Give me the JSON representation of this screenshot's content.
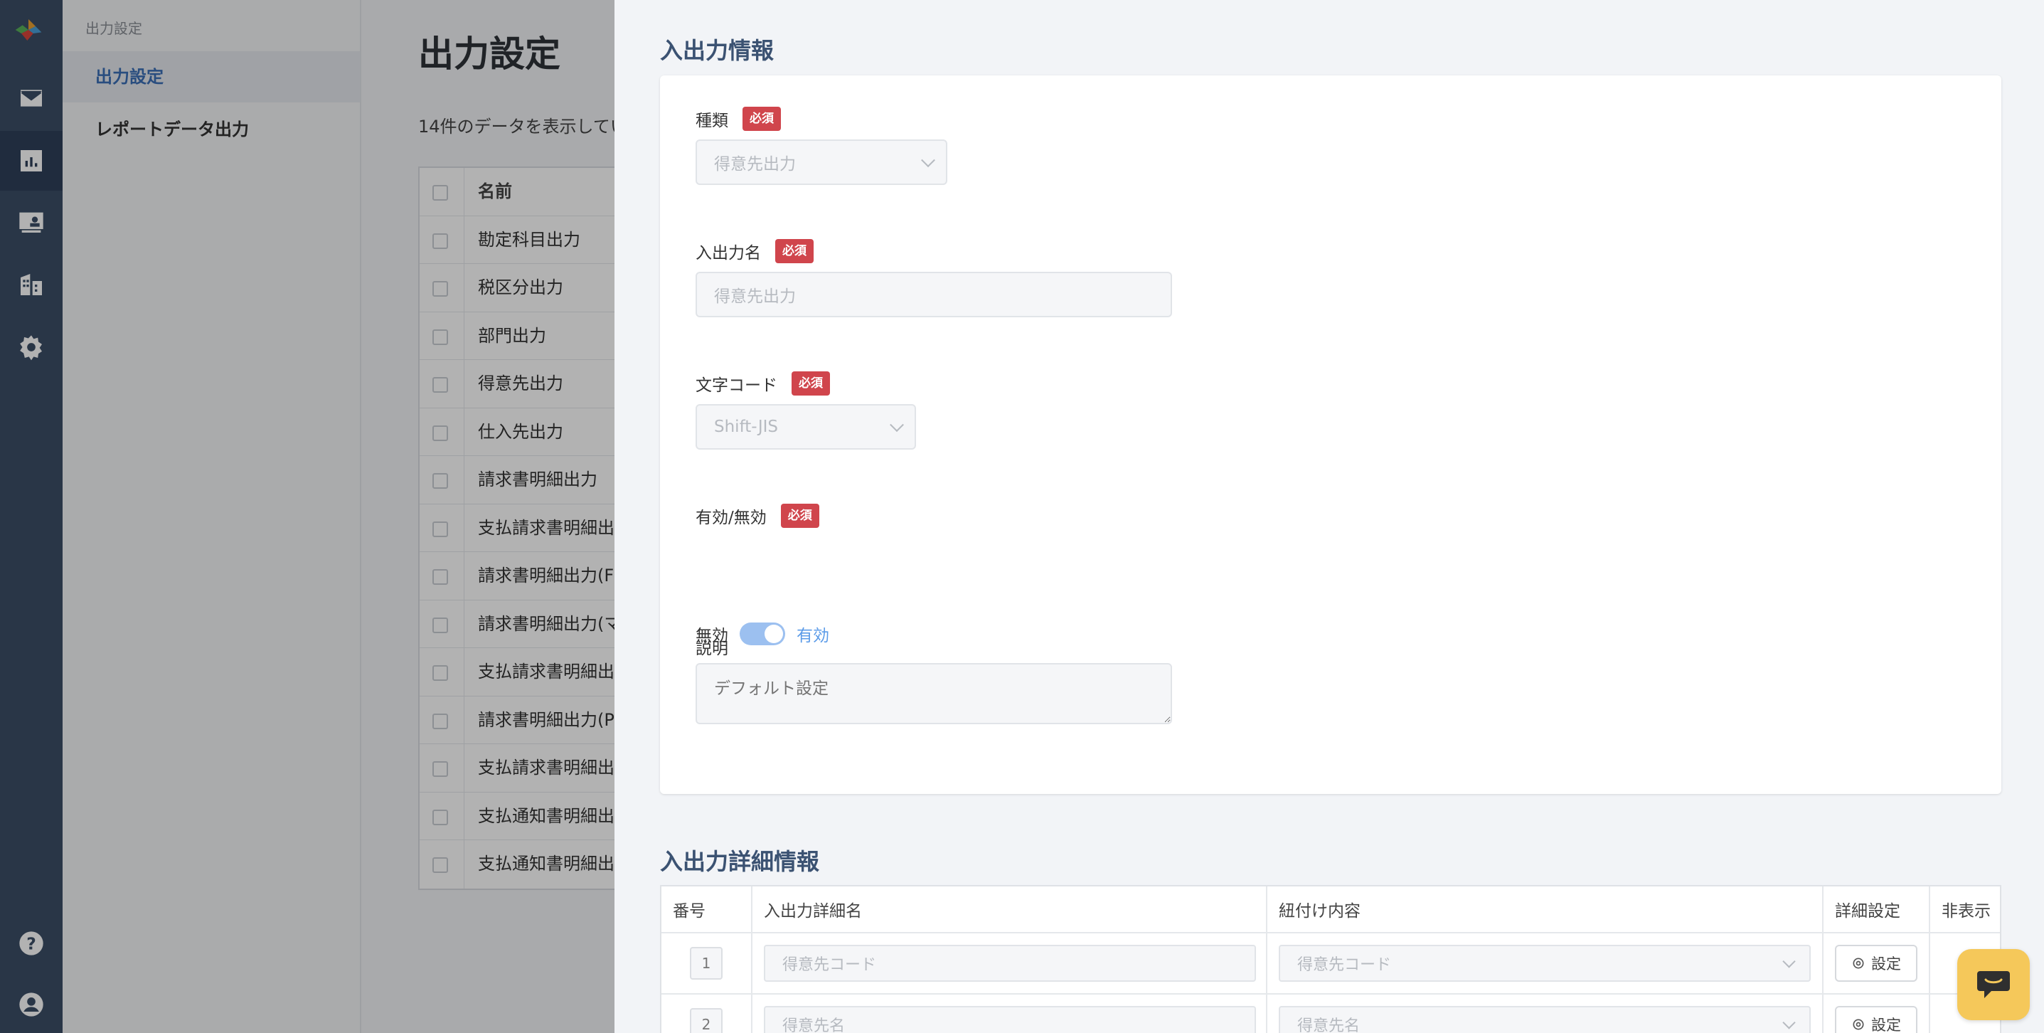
{
  "sidebar": {
    "breadcrumb": "出力設定",
    "items": [
      {
        "label": "出力設定",
        "active": true
      },
      {
        "label": "レポートデータ出力",
        "active": false
      }
    ]
  },
  "rail": {
    "icons": [
      "mail-icon",
      "chart-icon",
      "id-card-icon",
      "building-icon",
      "gear-icon",
      "help-icon",
      "user-icon"
    ]
  },
  "main": {
    "title": "出力設定",
    "count_text": "14件のデータを表示してい",
    "table": {
      "header": "名前",
      "rows": [
        "勘定科目出力",
        "税区分出力",
        "部門出力",
        "得意先出力",
        "仕入先出力",
        "請求書明細出力",
        "支払請求書明細出力",
        "請求書明細出力(FR",
        "請求書明細出力(マネ",
        "支払請求書明細出力",
        "請求書明細出力(PC",
        "支払請求書明細出力",
        "支払通知書明細出力",
        "支払通知書明細出力"
      ]
    }
  },
  "drawer": {
    "section1_title": "入出力情報",
    "required_label": "必須",
    "fields": {
      "type_label": "種類",
      "type_value": "得意先出力",
      "name_label": "入出力名",
      "name_value": "得意先出力",
      "encoding_label": "文字コード",
      "encoding_value": "Shift-JIS",
      "enabled_label": "有効/無効",
      "toggle_off_label": "無効",
      "toggle_on_label": "有効",
      "toggle_on": true,
      "description_label": "説明",
      "description_placeholder": "デフォルト設定"
    },
    "section2_title": "入出力詳細情報",
    "detail_table": {
      "headers": {
        "number": "番号",
        "detail_name": "入出力詳細名",
        "mapping": "紐付け内容",
        "settings": "詳細設定",
        "hidden": "非表示"
      },
      "rows": [
        {
          "number": "1",
          "detail_name": "得意先コード",
          "mapping": "得意先コード",
          "settings_label": "設定"
        },
        {
          "number": "2",
          "detail_name": "得意先名",
          "mapping": "得意先名",
          "settings_label": "設定"
        }
      ]
    }
  },
  "colors": {
    "rail": "#3c4e66",
    "accent": "#3b6fb6",
    "required": "#d0454c",
    "toggle": "#9cc0f0",
    "chat": "#f5c85a"
  }
}
